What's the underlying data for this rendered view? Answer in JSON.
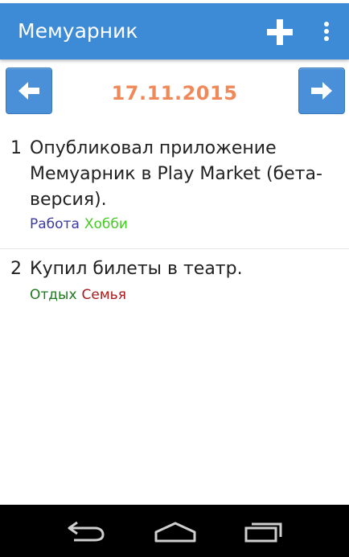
{
  "app": {
    "title": "Мемуарник"
  },
  "icons": {
    "add": "plus-icon",
    "menu": "overflow-menu-icon",
    "prev": "arrow-left-icon",
    "next": "arrow-right-icon",
    "back": "back-icon",
    "home": "home-icon",
    "recents": "recents-icon"
  },
  "date": {
    "label": "17.11.2015"
  },
  "entries": [
    {
      "number": "1",
      "text": "Опубликовал приложение Мемуарник в Play Market (бета-версия).",
      "tags": [
        {
          "label": "Работа",
          "color": "#3a3aa0"
        },
        {
          "label": "Хобби",
          "color": "#44cc22"
        }
      ]
    },
    {
      "number": "2",
      "text": "Купил билеты в театр.",
      "tags": [
        {
          "label": "Отдых",
          "color": "#1e7a1e"
        },
        {
          "label": "Семья",
          "color": "#aa1a1a"
        }
      ]
    }
  ],
  "colors": {
    "action_bar": "#3d8bd6",
    "date": "#f0895a",
    "nav_button": "#4a90d9"
  }
}
